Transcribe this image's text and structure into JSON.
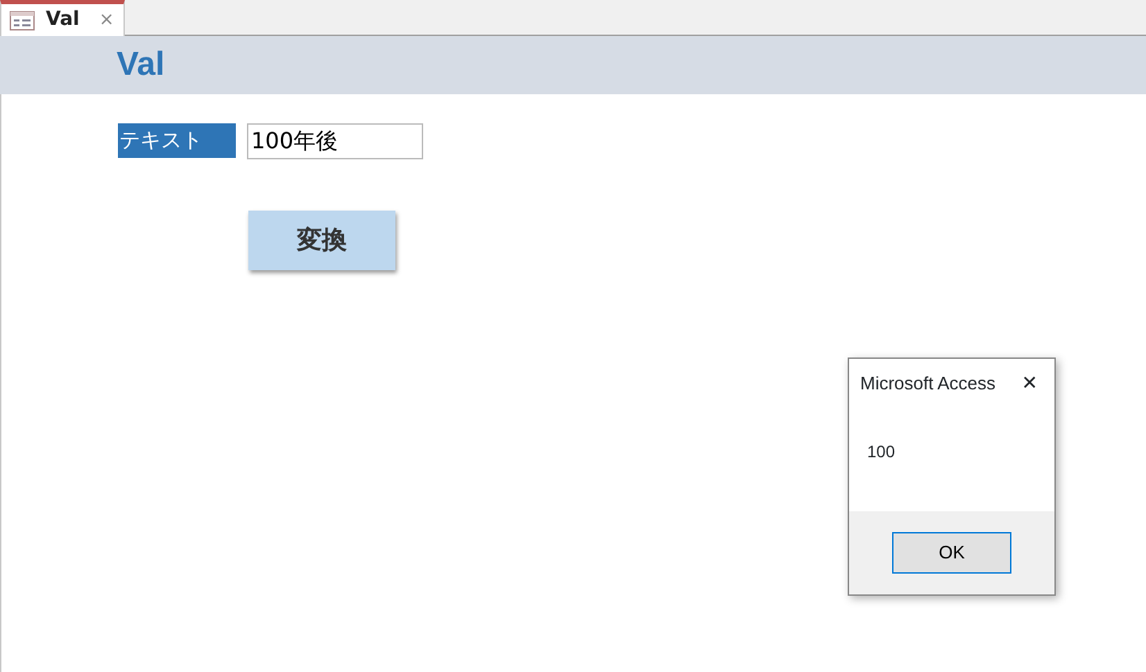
{
  "tabs": [
    {
      "label": "Val",
      "close": "×",
      "selected": true
    }
  ],
  "form": {
    "title": "Val",
    "field_label": "テキスト",
    "field_value": "100年後",
    "button": "変換"
  },
  "dialog": {
    "title": "Microsoft Access",
    "close": "✕",
    "message": "100",
    "buttons": [
      "OK"
    ]
  }
}
